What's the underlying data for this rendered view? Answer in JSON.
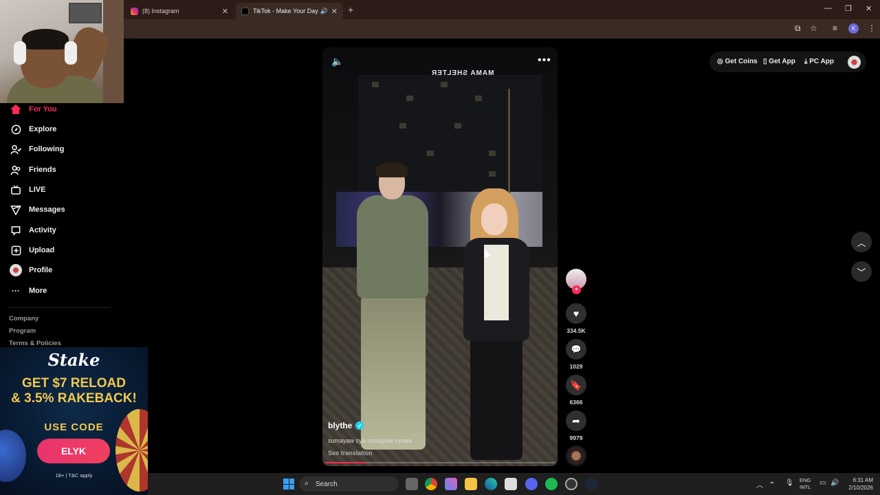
{
  "browser": {
    "tabs": [
      {
        "title": "(8) Instagram",
        "active": false
      },
      {
        "title": "TikTok - Make Your Day",
        "active": true
      }
    ],
    "new_tab": "+",
    "profile_initial": "K"
  },
  "sidebar": {
    "items": [
      {
        "label": "For You",
        "icon": "home-icon",
        "active": true
      },
      {
        "label": "Explore",
        "icon": "compass-icon"
      },
      {
        "label": "Following",
        "icon": "user-follow-icon"
      },
      {
        "label": "Friends",
        "icon": "friends-icon"
      },
      {
        "label": "LIVE",
        "icon": "live-icon"
      },
      {
        "label": "Messages",
        "icon": "send-icon"
      },
      {
        "label": "Activity",
        "icon": "activity-icon"
      },
      {
        "label": "Upload",
        "icon": "upload-icon"
      },
      {
        "label": "Profile",
        "icon": "avatar"
      },
      {
        "label": "More",
        "icon": "ellipsis-icon"
      }
    ],
    "footer": [
      "Company",
      "Program",
      "Terms & Policies"
    ]
  },
  "ad": {
    "brand": "Stake",
    "headline1": "GET $7 RELOAD",
    "headline2": "& 3.5% RAKEBACK!",
    "use_code": "USE CODE",
    "code": "ELYK",
    "terms": "18+ | T&C apply"
  },
  "video": {
    "sign_text": "MAMA SHELTER",
    "username": "blythe",
    "caption": "sumayaw sya sumayaw syaaa",
    "see_translation": "See translation",
    "progress": 0.18
  },
  "actions": {
    "likes": "334.5K",
    "comments": "1029",
    "bookmarks": "6366",
    "shares": "9979"
  },
  "topbar": {
    "get_coins": "Get Coins",
    "get_app": "Get App",
    "pc_app": "PC App"
  },
  "taskbar": {
    "search": "Search",
    "lang1": "ENG",
    "lang2": "INTL",
    "time": "6:31 AM",
    "date": "2/10/2026"
  },
  "colors": {
    "accent": "#fe2c55",
    "verified": "#20d5ec",
    "ad_gold": "#f2c94c"
  }
}
